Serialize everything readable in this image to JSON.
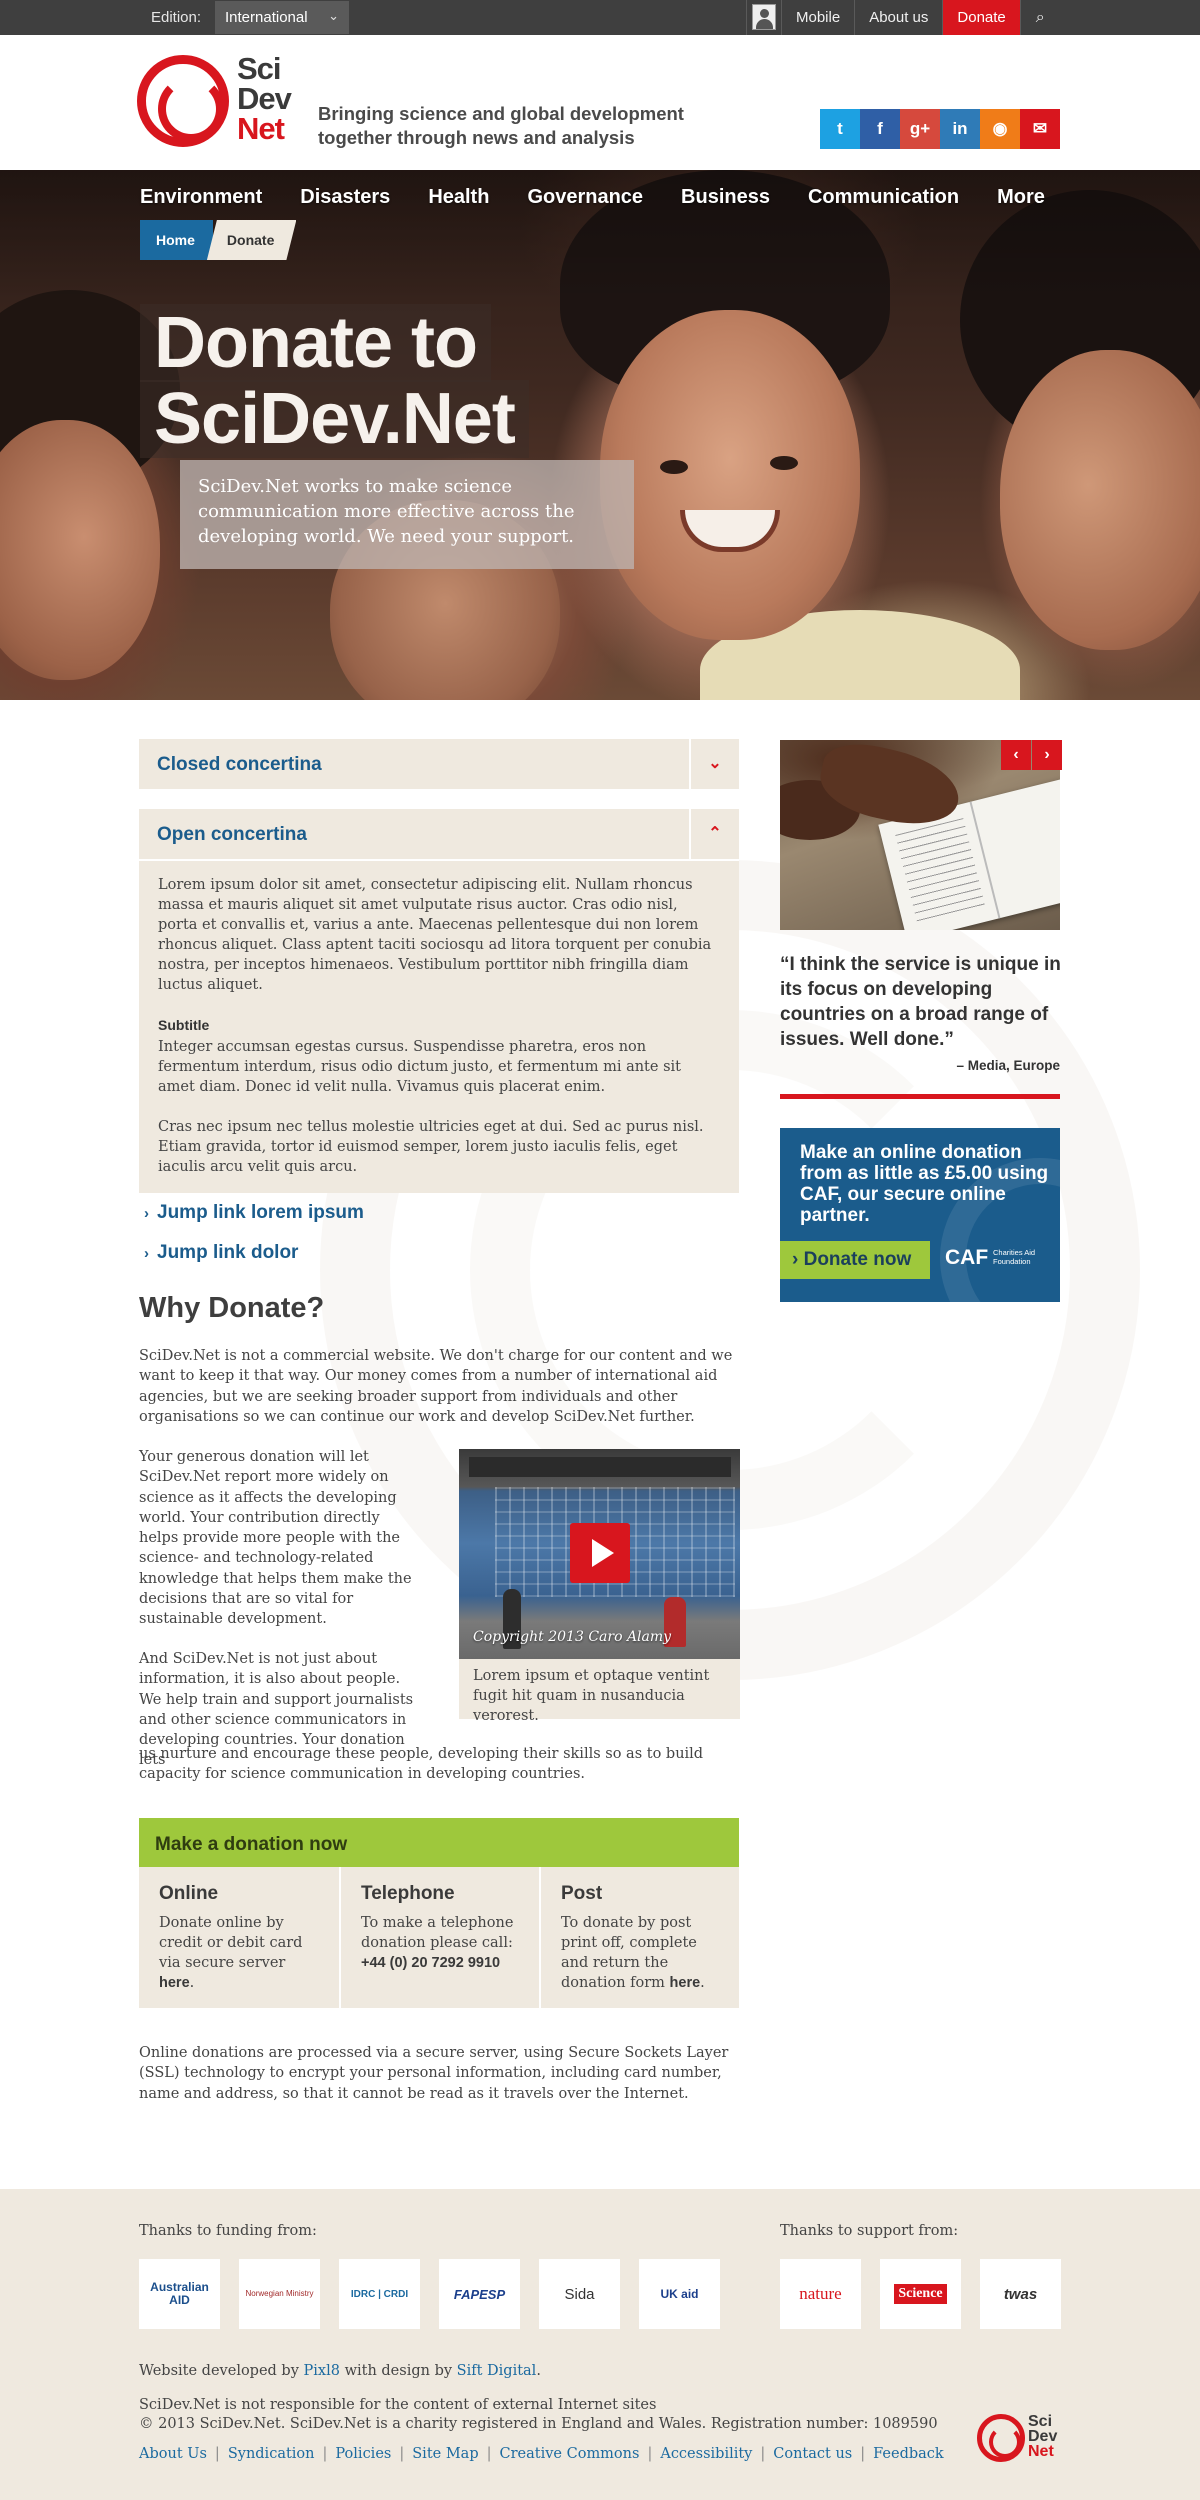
{
  "topbar": {
    "edition_label": "Edition:",
    "edition_value": "International",
    "links": [
      "Mobile",
      "About us",
      "Donate"
    ],
    "search_icon": "search-icon"
  },
  "header": {
    "logo_words": [
      "Sci",
      "Dev",
      "Net"
    ],
    "tagline_1": "Bringing science and global development",
    "tagline_2": "together through news and analysis",
    "social": [
      {
        "name": "twitter-icon",
        "glyph": "t",
        "color": "#1da1e2"
      },
      {
        "name": "facebook-icon",
        "glyph": "f",
        "color": "#2f5fa6"
      },
      {
        "name": "google-plus-icon",
        "glyph": "g+",
        "color": "#d6493d"
      },
      {
        "name": "linkedin-icon",
        "glyph": "in",
        "color": "#2f7bb7"
      },
      {
        "name": "rss-icon",
        "glyph": "◉",
        "color": "#f07c18"
      },
      {
        "name": "email-icon",
        "glyph": "✉",
        "color": "#d8161e"
      }
    ]
  },
  "nav": {
    "items": [
      "Environment",
      "Disasters",
      "Health",
      "Governance",
      "Business",
      "Communication",
      "More"
    ]
  },
  "breadcrumb": {
    "home": "Home",
    "current": "Donate"
  },
  "hero": {
    "title_line_1": "Donate to",
    "title_line_2": "SciDev.Net",
    "subtitle": "SciDev.Net works to make science communication more effective across the developing world. We need your support."
  },
  "concertinas": {
    "closed_title": "Closed concertina",
    "open_title": "Open concertina",
    "para_1": "Lorem ipsum dolor sit amet, consectetur adipiscing elit. Nullam rhoncus massa et mauris aliquet sit amet vulputate risus auctor. Cras odio nisl, porta et convallis et, varius a ante. Maecenas pellentesque dui non lorem rhoncus aliquet. Class aptent taciti sociosqu ad litora torquent per conubia nostra, per inceptos himenaeos. Vestibulum porttitor nibh fringilla diam luctus aliquet.",
    "subtitle": "Subtitle",
    "para_2": "Integer accumsan egestas cursus. Suspendisse pharetra, eros non fermentum interdum, risus odio dictum justo, et fermentum mi ante sit amet diam. Donec id velit nulla. Vivamus quis placerat enim.",
    "para_3": "Cras nec ipsum nec tellus molestie ultricies eget at dui. Sed ac purus nisl. Etiam gravida, tortor id euismod semper, lorem justo iaculis felis, eget iaculis arcu velit quis arcu."
  },
  "jump_links": [
    "Jump link lorem ipsum",
    "Jump link dolor"
  ],
  "why": {
    "heading": "Why Donate?",
    "para_1": "SciDev.Net is not a commercial website. We don't charge for our content and we want to keep it that way. Our money comes from a number of international aid agencies, but we are seeking broader support from individuals and other organisations so we can continue our work and develop SciDev.Net further.",
    "para_2": "Your generous donation will let SciDev.Net report more widely on science as it affects the developing world. Your contribution directly helps provide more people with the science- and technology-related knowledge that helps them make the decisions that are so vital for sustainable development.",
    "para_3a": "And SciDev.Net is not just about information, it is also about people. We help train and support journalists and other science communicators in developing countries. Your donation lets",
    "para_3b": "us nurture and encourage these people, developing their skills so as to build capacity for science communication in developing countries."
  },
  "video": {
    "copyright": "Copyright 2013 Caro Alamy",
    "caption": "Lorem ipsum et optaque ventint fugit hit quam in nusanducia verorest."
  },
  "donation": {
    "heading": "Make a donation now",
    "online_title": "Online",
    "online_text": "Donate online by credit or debit card via secure server",
    "online_link": "here",
    "phone_title": "Telephone",
    "phone_text": "To make a telephone donation please call:",
    "phone_number": "+44 (0) 20 7292 9910",
    "post_title": "Post",
    "post_text": "To donate by post print off, complete and return the donation form",
    "post_link": "here"
  },
  "ssl_note": "Online donations are processed via a secure server, using Secure Sockets Layer (SSL) technology to encrypt your personal information, including card number, name and address, so that it cannot be read as it travels over the Internet.",
  "sidebar": {
    "prev": "‹",
    "next": "›",
    "quote": "“I think the service is unique in its focus on developing countries on a broad range of issues. Well done.”",
    "quote_by": "– Media, Europe",
    "caf_text": "Make an online donation from as little as £5.00 using CAF, our secure online partner.",
    "caf_button": "Donate now",
    "caf_logo": "CAF",
    "caf_logo_sub": "Charities Aid Foundation"
  },
  "footer": {
    "funding_label": "Thanks to funding from:",
    "support_label": "Thanks to support from:",
    "funders": [
      "Australian AID",
      "Norwegian Ministry",
      "IDRC | CRDI",
      "FAPESP",
      "Sida",
      "UK aid"
    ],
    "supporters": [
      "nature",
      "Science",
      "twas"
    ],
    "dev_prefix": "Website developed by",
    "dev_name": "Pixl8",
    "dev_mid": "with design by",
    "design_name": "Sift Digital",
    "disclaimer": "SciDev.Net is not responsible for the content of external Internet sites",
    "copyright": "© 2013 SciDev.Net. SciDev.Net is a charity registered in England and Wales. Registration number: 1089590",
    "links": [
      "About Us",
      "Syndication",
      "Policies",
      "Site Map",
      "Creative Commons",
      "Accessibility",
      "Contact us",
      "Feedback"
    ]
  }
}
